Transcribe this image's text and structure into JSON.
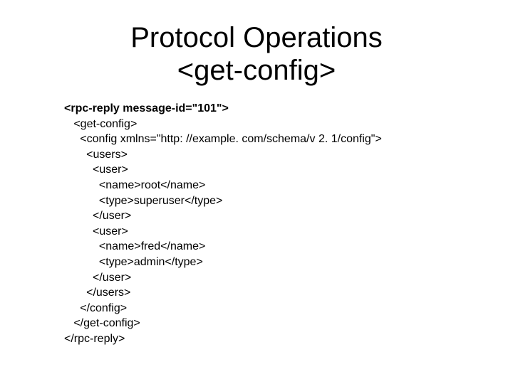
{
  "title_line1": "Protocol Operations",
  "title_line2": "<get-config>",
  "code": {
    "l01": "<rpc-reply message-id=\"101\">",
    "l02": "   <get-config>",
    "l03": "     <config xmlns=\"http: //example. com/schema/v 2. 1/config\">",
    "l04": "       <users>",
    "l05": "         <user>",
    "l06": "           <name>root</name>",
    "l07": "           <type>superuser</type>",
    "l08": "         </user>",
    "l09": "         <user>",
    "l10": "           <name>fred</name>",
    "l11": "           <type>admin</type>",
    "l12": "         </user>",
    "l13": "       </users>",
    "l14": "     </config>",
    "l15": "   </get-config>",
    "l16": "</rpc-reply>"
  }
}
